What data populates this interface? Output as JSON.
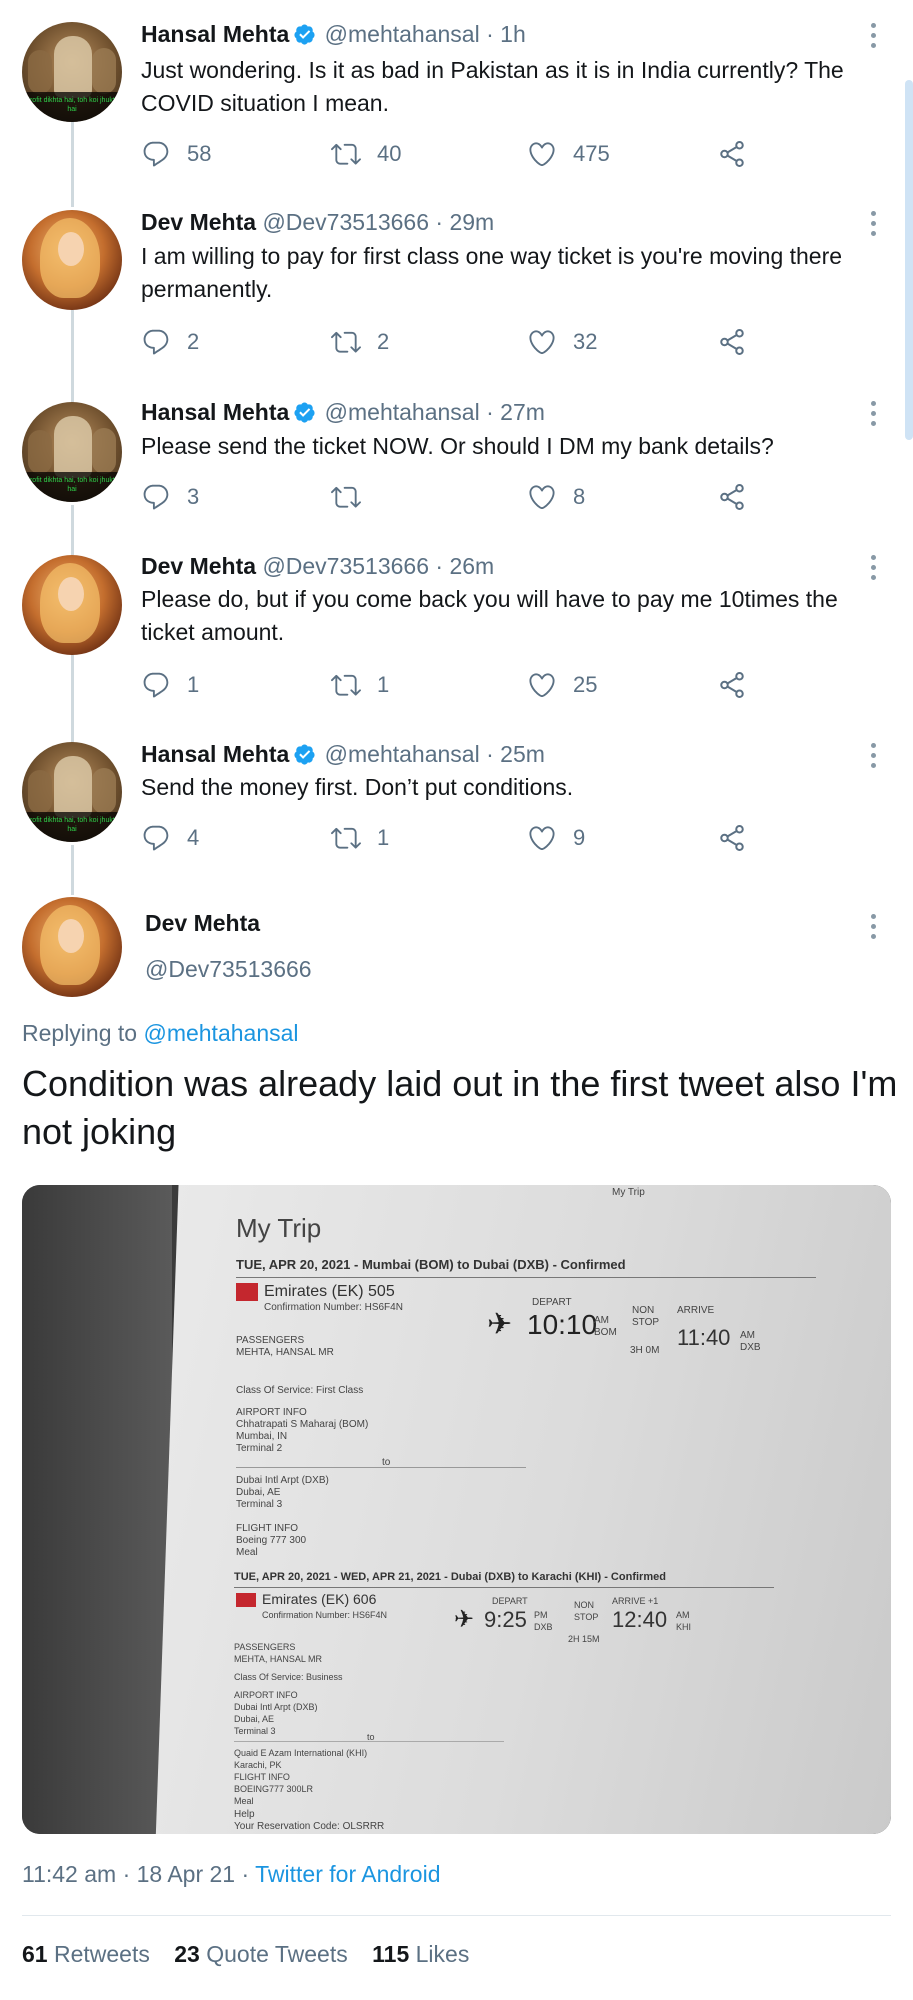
{
  "thread": [
    {
      "name": "Hansal Mehta",
      "verified": true,
      "handle": "@mehtahansal",
      "time": "· 1h",
      "text": "Just wondering. Is it as bad in Pakistan as it is in India currently? The COVID situation I mean.",
      "replies": "58",
      "retweets": "40",
      "likes": "475",
      "avatar_caption": "Profit dikhta hai, toh koi jhukta hai"
    },
    {
      "name": "Dev Mehta",
      "verified": false,
      "handle": "@Dev73513666",
      "time": "· 29m",
      "text": "I am willing to pay for first class one way ticket is you're moving there permanently.",
      "replies": "2",
      "retweets": "2",
      "likes": "32"
    },
    {
      "name": "Hansal Mehta",
      "verified": true,
      "handle": "@mehtahansal",
      "time": "· 27m",
      "text": "Please send the ticket NOW. Or should I DM my bank details?",
      "replies": "3",
      "retweets": "",
      "likes": "8",
      "avatar_caption": "Profit dikhta hai, toh koi jhukta hai"
    },
    {
      "name": "Dev Mehta",
      "verified": false,
      "handle": "@Dev73513666",
      "time": "· 26m",
      "text": "Please do, but if you come back you will have to pay me 10times the ticket amount.",
      "replies": "1",
      "retweets": "1",
      "likes": "25"
    },
    {
      "name": "Hansal Mehta",
      "verified": true,
      "handle": "@mehtahansal",
      "time": "· 25m",
      "text": "Send the money first. Don’t put conditions.",
      "replies": "4",
      "retweets": "1",
      "likes": "9",
      "avatar_caption": "Profit dikhta hai, toh koi jhukta hai"
    }
  ],
  "main_tweet": {
    "name": "Dev Mehta",
    "handle": "@Dev73513666",
    "replying_prefix": "Replying to",
    "replying_to": "@mehtahansal",
    "text": "Condition was already laid out in the first tweet also I'm not joking",
    "timestamp": "11:42 am · 18 Apr 21 ·",
    "source": "Twitter for Android",
    "retweets_count": "61",
    "retweets_label": "Retweets",
    "quotes_count": "23",
    "quotes_label": "Quote Tweets",
    "likes_count": "115",
    "likes_label": "Likes"
  },
  "ticket_photo": {
    "title": "My Trip",
    "corner": "My Trip",
    "leg1": {
      "header": "TUE, APR 20, 2021 - Mumbai (BOM) to Dubai (DXB) - Confirmed",
      "airline": "Emirates (EK) 505",
      "confirmation": "Confirmation Number: HS6F4N",
      "depart_label": "DEPART",
      "depart_time": "10:10",
      "depart_ampm": "AM\nBOM",
      "nonstop": "NON\nSTOP",
      "duration": "3H 0M",
      "arrive_label": "ARRIVE",
      "arrive_time": "11:40",
      "arrive_ampm": "AM\nDXB",
      "passengers": "PASSENGERS\nMEHTA, HANSAL MR",
      "class": "Class Of Service: First Class",
      "airport_info": "AIRPORT INFO\nChhatrapati S Maharaj (BOM)\nMumbai, IN\nTerminal 2",
      "to": "to",
      "arrival_airport": "Dubai Intl Arpt (DXB)\nDubai, AE\nTerminal 3",
      "flight_info": "FLIGHT INFO\nBoeing 777 300\nMeal"
    },
    "leg2": {
      "header": "TUE, APR 20, 2021 - WED, APR 21, 2021 - Dubai (DXB) to Karachi (KHI) - Confirmed",
      "airline": "Emirates (EK) 606",
      "confirmation": "Confirmation Number: HS6F4N",
      "depart_label": "DEPART",
      "depart_time": "9:25",
      "depart_ampm": "PM\nDXB",
      "nonstop": "NON\nSTOP",
      "duration": "2H 15M",
      "arrive_label": "ARRIVE +1",
      "arrive_time": "12:40",
      "arrive_ampm": "AM\nKHI",
      "passengers": "PASSENGERS\nMEHTA, HANSAL MR",
      "class": "Class Of Service: Business",
      "airport_info": "AIRPORT INFO\nDubai Intl Arpt (DXB)\nDubai, AE\nTerminal 3",
      "to": "to",
      "arrival_airport": "Quaid E Azam International (KHI)\nKarachi, PK",
      "flight_info": "FLIGHT INFO\nBOEING777 300LR\nMeal"
    },
    "footer": "Help\nYour Reservation Code: OLSRRR"
  },
  "icons": {
    "verified": "verified-badge-icon",
    "reply": "reply-icon",
    "retweet": "retweet-icon",
    "like": "heart-icon",
    "share": "share-icon",
    "more": "more-vertical-icon"
  },
  "colors": {
    "link": "#1b95e0",
    "muted": "#5b7083",
    "text": "#14171a",
    "thread_line": "#cfd9de",
    "verified": "#1da1f2"
  }
}
